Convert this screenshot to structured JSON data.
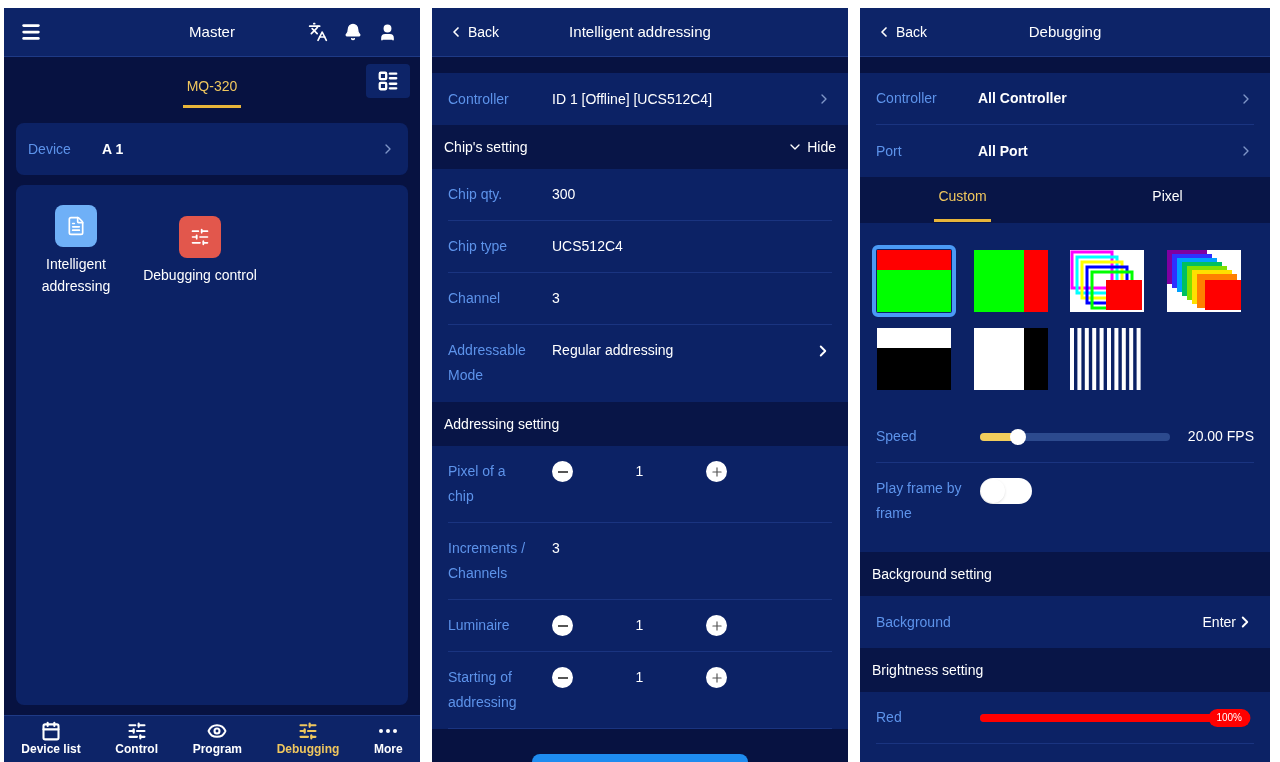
{
  "home": {
    "title": "Master",
    "tabs": [
      {
        "label": "MQ-320",
        "selected": true
      }
    ],
    "device": {
      "label": "Device",
      "value": "A 1"
    },
    "apps": [
      {
        "kind": "addressing",
        "label": "Intelligent addressing"
      },
      {
        "kind": "debugging",
        "label": "Debugging control"
      }
    ],
    "nav": [
      {
        "kind": "calendar",
        "label": "Device list",
        "selected": false
      },
      {
        "kind": "sliders",
        "label": "Control",
        "selected": false
      },
      {
        "kind": "eye",
        "label": "Program",
        "selected": false
      },
      {
        "kind": "sliders",
        "label": "Debugging",
        "selected": true
      },
      {
        "kind": "dots",
        "label": "More",
        "selected": false
      }
    ]
  },
  "addressing": {
    "back": "Back",
    "title": "Intelligent addressing",
    "controller": {
      "label": "Controller",
      "value": "ID 1 [Offline] [UCS512C4]"
    },
    "sections": [
      {
        "title": "Chip's setting",
        "toggle": "Hide",
        "rows": [
          {
            "kind": "value",
            "label": "Chip qty.",
            "value": "300"
          },
          {
            "kind": "value",
            "label": "Chip type",
            "value": "UCS512C4"
          },
          {
            "kind": "value",
            "label": "Channel",
            "value": "3"
          },
          {
            "kind": "select",
            "label": "Addressable Mode",
            "value": "Regular addressing"
          }
        ]
      },
      {
        "title": "Addressing setting",
        "rows": [
          {
            "kind": "stepper",
            "label": "Pixel of a chip",
            "value": "1"
          },
          {
            "kind": "value",
            "label": "Increments / Channels",
            "value": "3"
          },
          {
            "kind": "stepper",
            "label": "Luminaire",
            "value": "1"
          },
          {
            "kind": "stepper",
            "label": "Starting of addressing",
            "value": "1"
          }
        ]
      }
    ]
  },
  "debugging": {
    "back": "Back",
    "title": "Debugging",
    "selectors": [
      {
        "label": "Controller",
        "value": "All Controller"
      },
      {
        "label": "Port",
        "value": "All Port"
      }
    ],
    "tabs": [
      {
        "label": "Custom",
        "selected": true
      },
      {
        "label": "Pixel",
        "selected": false
      }
    ],
    "patterns": [
      {
        "kind": "red-green-rows",
        "selected": true
      },
      {
        "kind": "green-red-columns",
        "selected": false
      },
      {
        "kind": "nested-corners",
        "selected": false
      },
      {
        "kind": "rainbow-steps",
        "selected": false
      },
      {
        "kind": "white-black-rows",
        "selected": false
      },
      {
        "kind": "white-black-columns",
        "selected": false
      },
      {
        "kind": "stripes",
        "selected": false
      }
    ],
    "speed": {
      "label": "Speed",
      "level": 0.2,
      "reading": "20.00 FPS"
    },
    "play": {
      "label": "Play frame by frame",
      "on": false
    },
    "background": {
      "title": "Background setting",
      "label": "Background",
      "value": "Enter"
    },
    "brightness": {
      "title": "Brightness setting",
      "channels": [
        {
          "label": "Red",
          "level": 1,
          "reading": "100%",
          "color": "#ff0000"
        }
      ]
    }
  }
}
